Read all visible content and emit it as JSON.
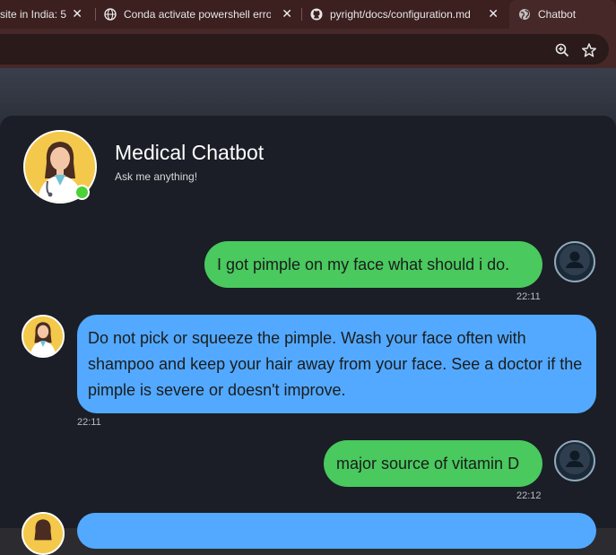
{
  "browser": {
    "tabs": [
      {
        "title": "site in India: 5",
        "favicon": "generic-icon"
      },
      {
        "title": "Conda activate powershell error",
        "favicon": "globe-icon"
      },
      {
        "title": "pyright/docs/configuration.md",
        "favicon": "github-icon"
      },
      {
        "title": "Chatbot",
        "favicon": "globe-icon",
        "active": true
      }
    ],
    "close_glyph": "✕",
    "zoom_icon": "zoom-in-icon",
    "bookmark_icon": "star-icon"
  },
  "chat": {
    "title": "Medical Chatbot",
    "subtitle": "Ask me anything!",
    "status": "online",
    "messages": [
      {
        "role": "user",
        "text": "I got pimple on my face what should i do.",
        "time": "22:11"
      },
      {
        "role": "bot",
        "text": "Do not pick or squeeze the pimple. Wash your face often with shampoo and keep your hair away from your face. See a doctor if the pimple is severe or doesn't improve.",
        "time": "22:11"
      },
      {
        "role": "user",
        "text": "major source of vitamin D",
        "time": "22:12"
      },
      {
        "role": "bot",
        "text": "",
        "time": ""
      }
    ]
  },
  "colors": {
    "user_bubble": "#49c95e",
    "bot_bubble": "#52a9ff",
    "card_bg": "#1b1e26",
    "online": "#4cd137"
  }
}
